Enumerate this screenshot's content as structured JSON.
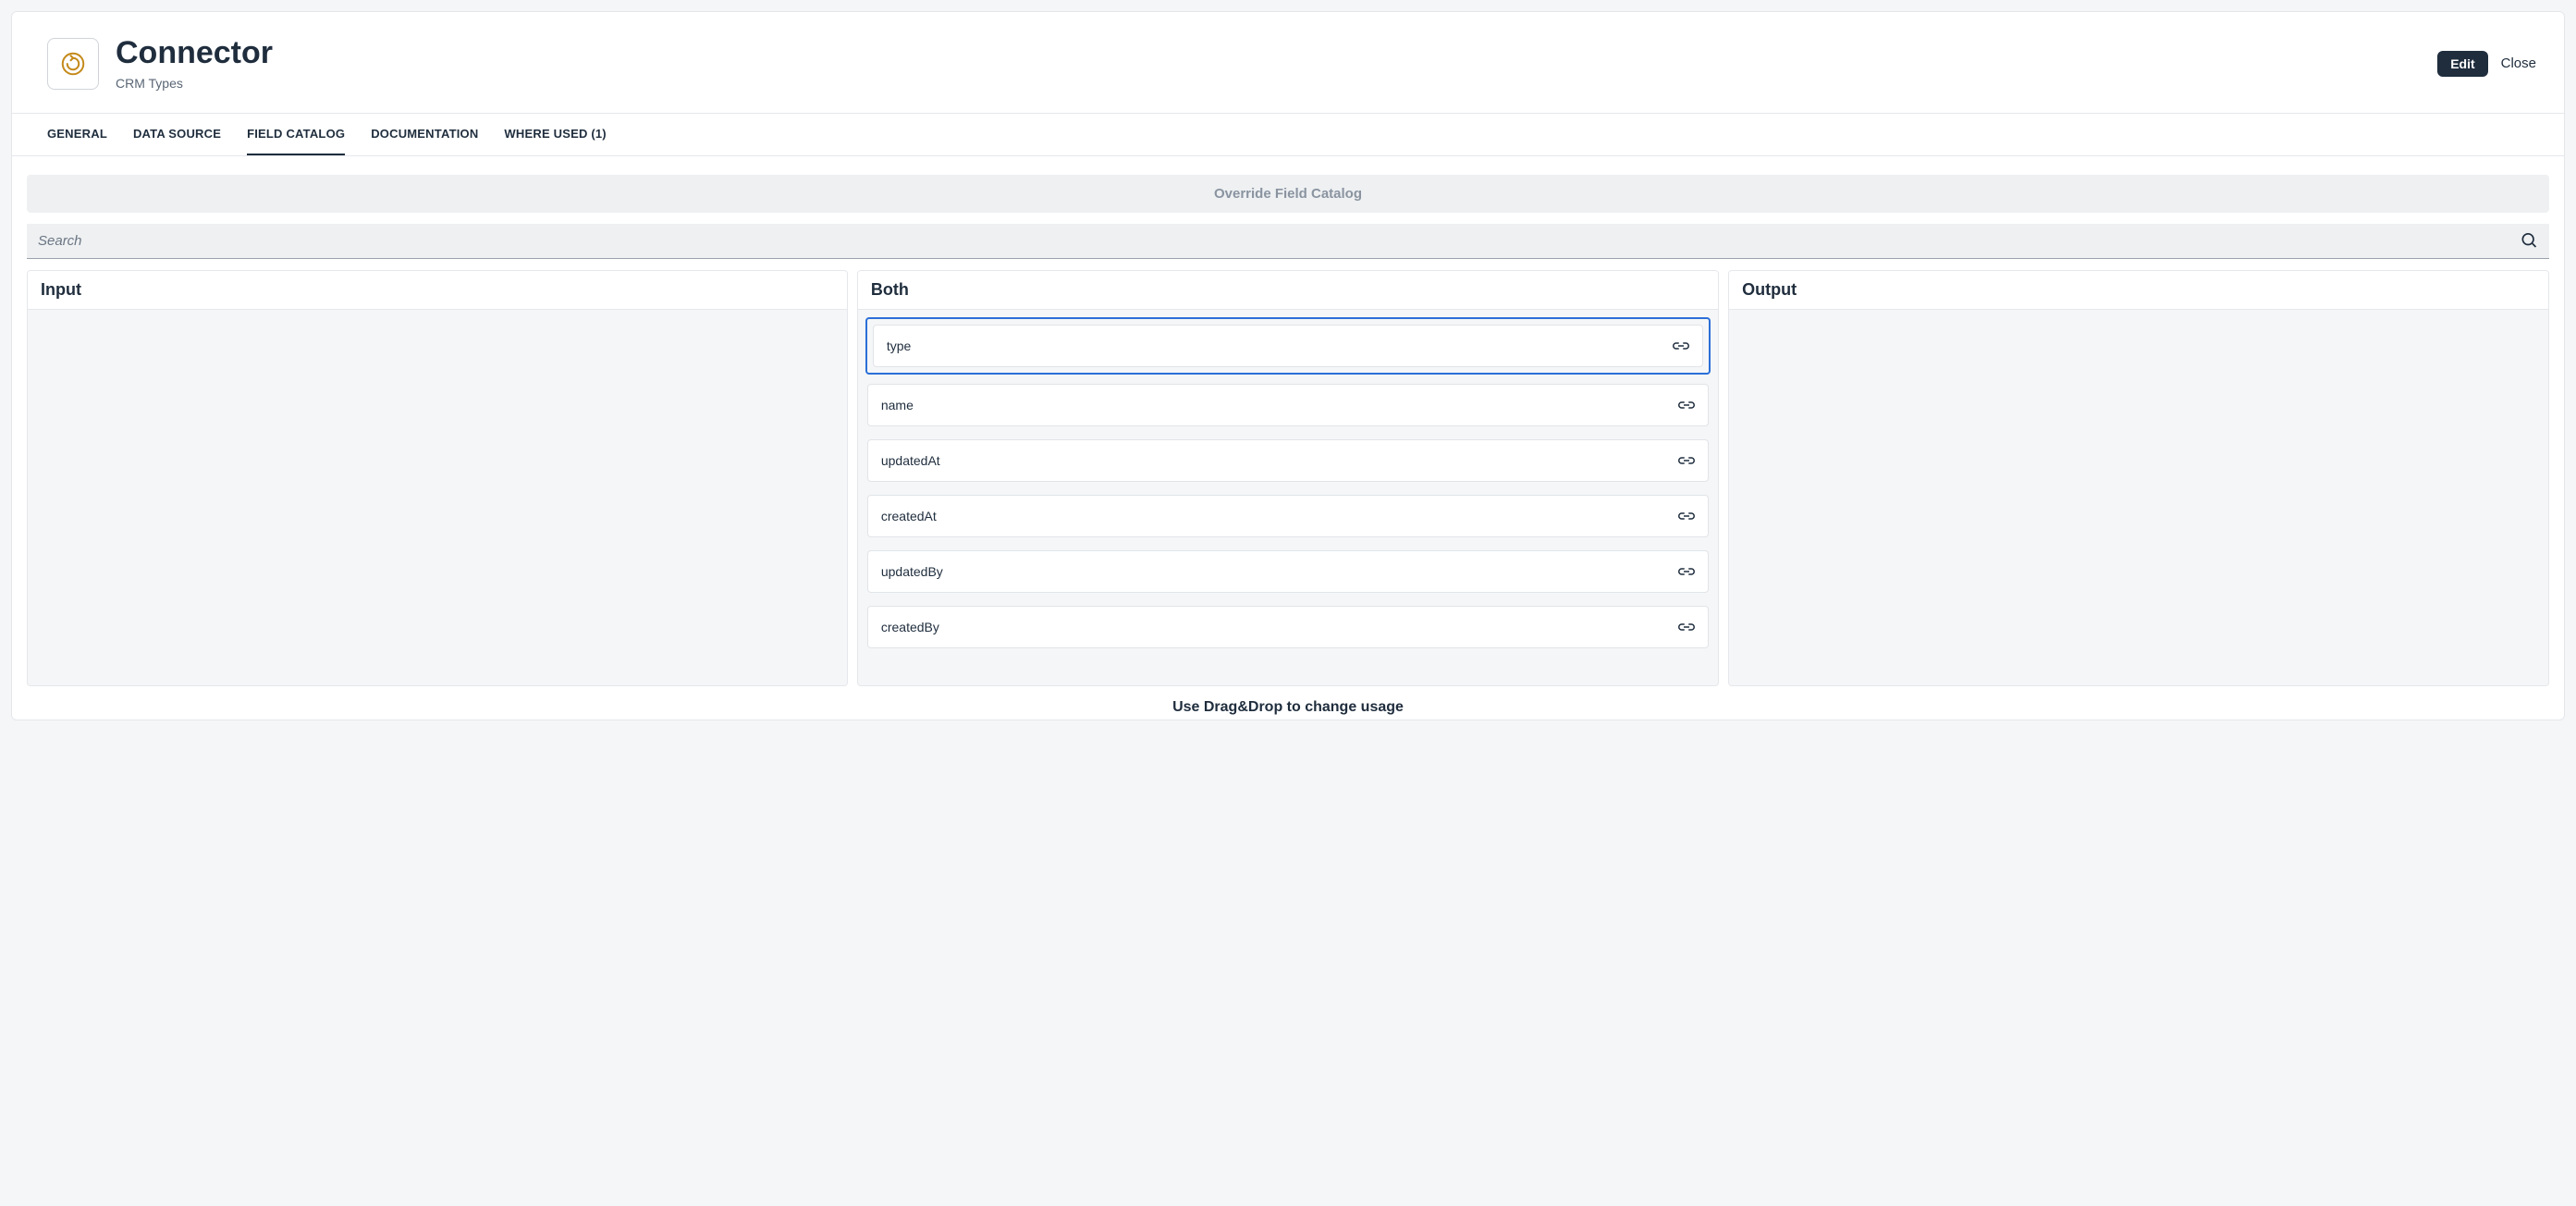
{
  "header": {
    "title": "Connector",
    "subtitle": "CRM Types",
    "edit_label": "Edit",
    "close_label": "Close"
  },
  "tabs": {
    "general": "GENERAL",
    "data_source": "DATA SOURCE",
    "field_catalog": "FIELD CATALOG",
    "documentation": "DOCUMENTATION",
    "where_used": "WHERE USED (1)",
    "active": "field_catalog"
  },
  "toolbar": {
    "override_label": "Override Field Catalog",
    "search_placeholder": "Search"
  },
  "columns": {
    "input_title": "Input",
    "both_title": "Both",
    "output_title": "Output",
    "hint": "Use Drag&Drop to change usage"
  },
  "fields_both": {
    "0": {
      "label": "type"
    },
    "1": {
      "label": "name"
    },
    "2": {
      "label": "updatedAt"
    },
    "3": {
      "label": "createdAt"
    },
    "4": {
      "label": "updatedBy"
    },
    "5": {
      "label": "createdBy"
    }
  },
  "icons": {
    "connector": "connector-icon",
    "search": "search-icon",
    "link": "link-icon"
  }
}
